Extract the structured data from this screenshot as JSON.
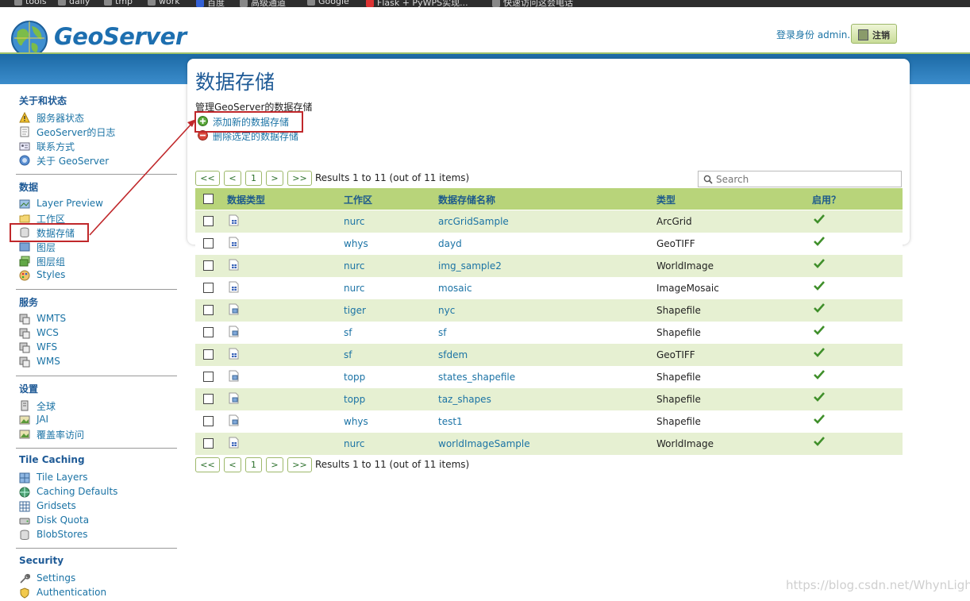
{
  "bookmarks": [
    "tools",
    "daily",
    "tmp",
    "work",
    "百度",
    "高级通道",
    "Google",
    "Flask + PyWPS实现...",
    "快速访问这会电话"
  ],
  "header": {
    "logo_text": "GeoServer",
    "login_text": "登录身份 admin.",
    "logout_label": "注销"
  },
  "sidebar": {
    "about": {
      "title": "关于和状态",
      "items": [
        "服务器状态",
        "GeoServer的日志",
        "联系方式",
        "关于 GeoServer"
      ]
    },
    "data": {
      "title": "数据",
      "items": [
        "Layer Preview",
        "工作区",
        "数据存储",
        "图层",
        "图层组",
        "Styles"
      ]
    },
    "services": {
      "title": "服务",
      "items": [
        "WMTS",
        "WCS",
        "WFS",
        "WMS"
      ]
    },
    "settings": {
      "title": "设置",
      "items": [
        "全球",
        "JAI",
        "覆盖率访问"
      ]
    },
    "tile_caching": {
      "title": "Tile Caching",
      "items": [
        "Tile Layers",
        "Caching Defaults",
        "Gridsets",
        "Disk Quota",
        "BlobStores"
      ]
    },
    "security": {
      "title": "Security",
      "items": [
        "Settings",
        "Authentication"
      ]
    }
  },
  "main": {
    "title": "数据存储",
    "description": "管理GeoServer的数据存储",
    "actions": {
      "add": "添加新的数据存储",
      "remove": "删除选定的数据存储"
    },
    "pager": {
      "first": "<<",
      "prev": "<",
      "page": "1",
      "next": ">",
      "last": ">>",
      "results": "Results 1 to 11 (out of 11 items)"
    },
    "search_placeholder": "Search",
    "columns": {
      "type_icon": "数据类型",
      "workspace": "工作区",
      "store_name": "数据存储名称",
      "type": "类型",
      "enabled": "启用？"
    },
    "rows": [
      {
        "workspace": "nurc",
        "name": "arcGridSample",
        "type": "ArcGrid",
        "kind": "raster",
        "enabled": true
      },
      {
        "workspace": "whys",
        "name": "dayd",
        "type": "GeoTIFF",
        "kind": "raster",
        "enabled": true
      },
      {
        "workspace": "nurc",
        "name": "img_sample2",
        "type": "WorldImage",
        "kind": "raster",
        "enabled": true
      },
      {
        "workspace": "nurc",
        "name": "mosaic",
        "type": "ImageMosaic",
        "kind": "raster",
        "enabled": true
      },
      {
        "workspace": "tiger",
        "name": "nyc",
        "type": "Shapefile",
        "kind": "vector",
        "enabled": true
      },
      {
        "workspace": "sf",
        "name": "sf",
        "type": "Shapefile",
        "kind": "vector",
        "enabled": true
      },
      {
        "workspace": "sf",
        "name": "sfdem",
        "type": "GeoTIFF",
        "kind": "raster",
        "enabled": true
      },
      {
        "workspace": "topp",
        "name": "states_shapefile",
        "type": "Shapefile",
        "kind": "vector",
        "enabled": true
      },
      {
        "workspace": "topp",
        "name": "taz_shapes",
        "type": "Shapefile",
        "kind": "vector",
        "enabled": true
      },
      {
        "workspace": "whys",
        "name": "test1",
        "type": "Shapefile",
        "kind": "vector",
        "enabled": true
      },
      {
        "workspace": "nurc",
        "name": "worldImageSample",
        "type": "WorldImage",
        "kind": "raster",
        "enabled": true
      }
    ]
  },
  "watermark": "https://blog.csdn.net/WhynLight",
  "colors": {
    "accent": "#1e5a96",
    "row_alt": "#e6f0d2",
    "header_green": "#b8d47a",
    "annotation": "#c0282b"
  }
}
